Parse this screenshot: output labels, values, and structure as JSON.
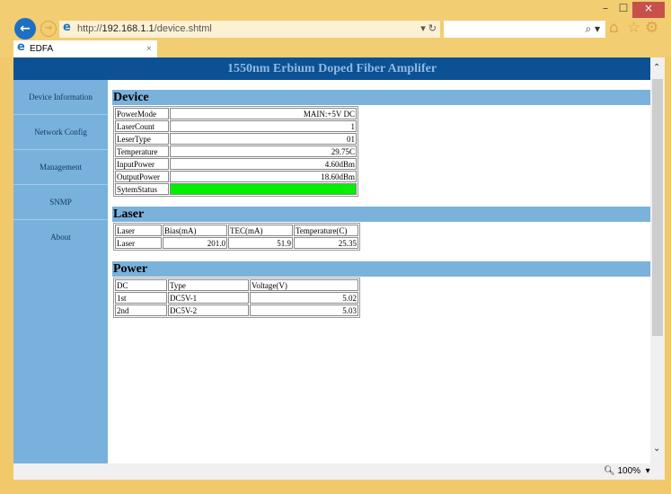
{
  "browser": {
    "url_prefix": "http://",
    "url_host": "192.168.1.1",
    "url_path": "/device.shtml",
    "tab_title": "EDFA",
    "tab_close": "×",
    "zoom": "100%",
    "search_icon": "⌕ ▾",
    "refresh": "▾ ↻",
    "min": "–",
    "max": "☐",
    "close": "×"
  },
  "page": {
    "title": "1550nm Erbium Doped Fiber Amplifer"
  },
  "sidebar": {
    "items": [
      {
        "label": "Device Information"
      },
      {
        "label": "Network Config"
      },
      {
        "label": "Management"
      },
      {
        "label": "SNMP"
      },
      {
        "label": "About"
      }
    ]
  },
  "device": {
    "heading": "Device",
    "rows": [
      {
        "label": "PowerMode",
        "value": "MAIN:+5V DC"
      },
      {
        "label": "LaserCount",
        "value": "1"
      },
      {
        "label": "LeserType",
        "value": "01"
      },
      {
        "label": "Temperature",
        "value": "29.75C"
      },
      {
        "label": "InputPower",
        "value": "4.60dBm"
      },
      {
        "label": "OutputPower",
        "value": "18.60dBm"
      },
      {
        "label": "SytemStatus",
        "value": "OK"
      }
    ],
    "status_color": "#00f000"
  },
  "laser": {
    "heading": "Laser",
    "headers": [
      "Laser",
      "Bias(mA)",
      "TEC(mA)",
      "Temperature(C)"
    ],
    "row": [
      "Laser",
      "201.0",
      "51.9",
      "25.35"
    ]
  },
  "power": {
    "heading": "Power",
    "headers": [
      "DC",
      "Type",
      "Voltage(V)"
    ],
    "rows": [
      [
        "1st",
        "DC5V-1",
        "5.02"
      ],
      [
        "2nd",
        "DC5V-2",
        "5.03"
      ]
    ]
  }
}
